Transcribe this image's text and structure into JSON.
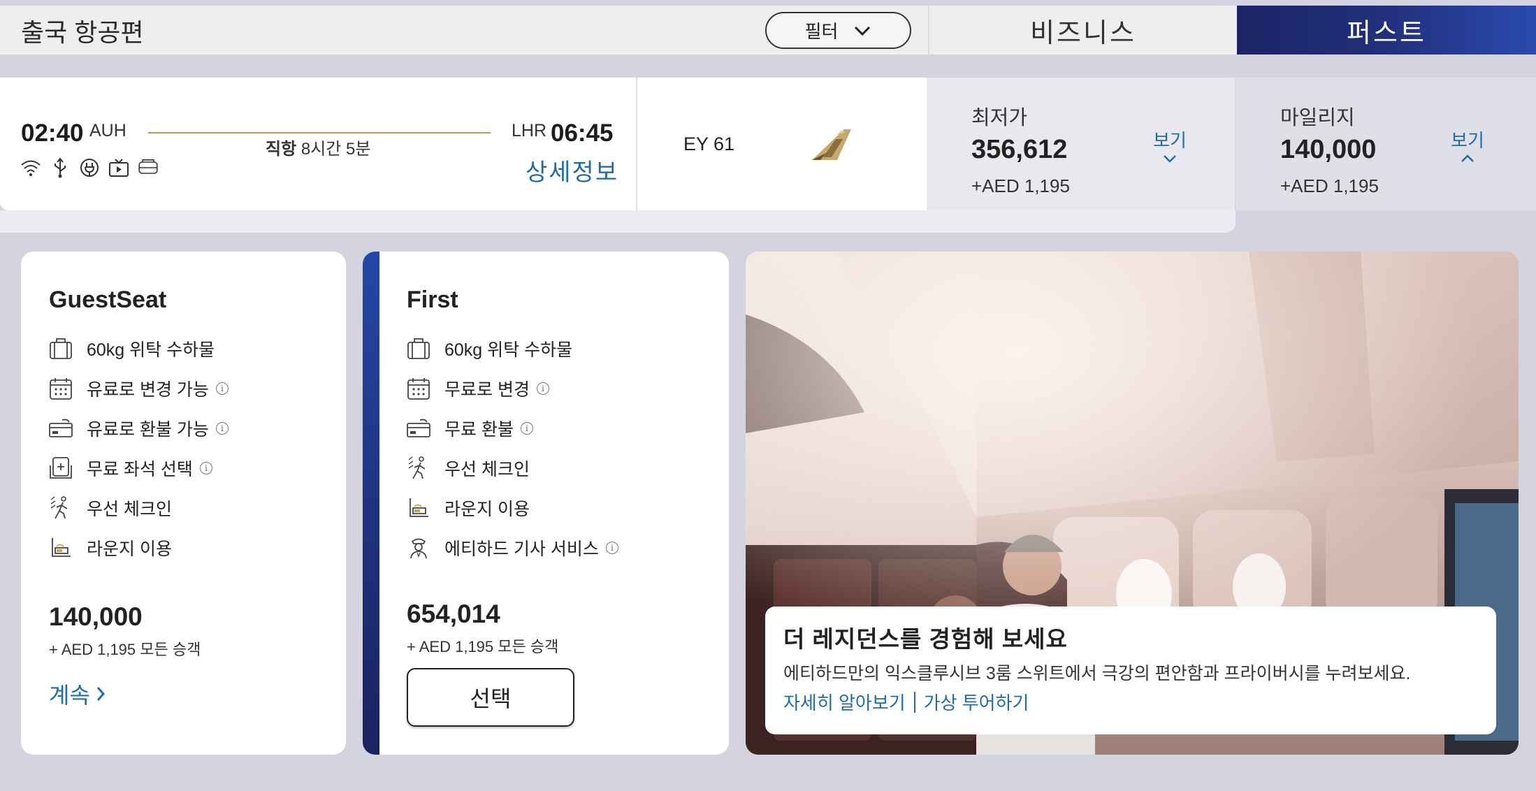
{
  "header": {
    "title": "출국 항공편",
    "filter_label": "필터",
    "tab_business": "비즈니스",
    "tab_first": "퍼스트"
  },
  "flight": {
    "departure_time": "02:40",
    "departure_code": "AUH",
    "direct_label": "직항",
    "duration": "8시간 5분",
    "arrival_code": "LHR",
    "arrival_time": "06:45",
    "details_link": "상세정보",
    "flight_number": "EY 61",
    "amenities": [
      "wifi-icon",
      "usb-icon",
      "power-outlet-icon",
      "entertainment-icon",
      "seat-icon"
    ]
  },
  "prices": {
    "lowest": {
      "label": "최저가",
      "amount": "356,612",
      "sub": "+AED 1,195",
      "view": "보기"
    },
    "miles": {
      "label": "마일리지",
      "amount": "140,000",
      "sub": "+AED 1,195",
      "view": "보기"
    }
  },
  "fares": {
    "guest": {
      "name": "GuestSeat",
      "features": [
        {
          "icon": "baggage-icon",
          "text": "60kg 위탁 수하물",
          "info": false
        },
        {
          "icon": "calendar-icon",
          "text": "유료로 변경 가능",
          "info": true
        },
        {
          "icon": "refund-icon",
          "text": "유료로 환불 가능",
          "info": true
        },
        {
          "icon": "seat-select-icon",
          "text": "무료 좌석 선택",
          "info": true
        },
        {
          "icon": "priority-checkin-icon",
          "text": "우선 체크인",
          "info": false
        },
        {
          "icon": "lounge-icon",
          "text": "라운지 이용",
          "info": false
        }
      ],
      "price": "140,000",
      "price_sub": "+ AED 1,195 모든 승객",
      "action": "계속"
    },
    "first": {
      "name": "First",
      "features": [
        {
          "icon": "baggage-icon",
          "text": "60kg 위탁 수하물",
          "info": false
        },
        {
          "icon": "calendar-icon",
          "text": "무료로 변경",
          "info": true
        },
        {
          "icon": "refund-icon",
          "text": "무료 환불",
          "info": true
        },
        {
          "icon": "priority-checkin-icon",
          "text": "우선 체크인",
          "info": false
        },
        {
          "icon": "lounge-icon",
          "text": "라운지 이용",
          "info": false
        },
        {
          "icon": "chauffeur-icon",
          "text": "에티하드 기사 서비스",
          "info": true
        }
      ],
      "price": "654,014",
      "price_sub": "+ AED 1,195 모든 승객",
      "action": "선택"
    }
  },
  "promo": {
    "title": "더 레지던스를 경험해 보세요",
    "description": "에티하드만의 익스클루시브 3룸 스위트에서 극강의 편안함과 프라이버시를 누려보세요.",
    "link_learn_more": "자세히 알아보기",
    "link_virtual_tour": "가상 투어하기"
  }
}
